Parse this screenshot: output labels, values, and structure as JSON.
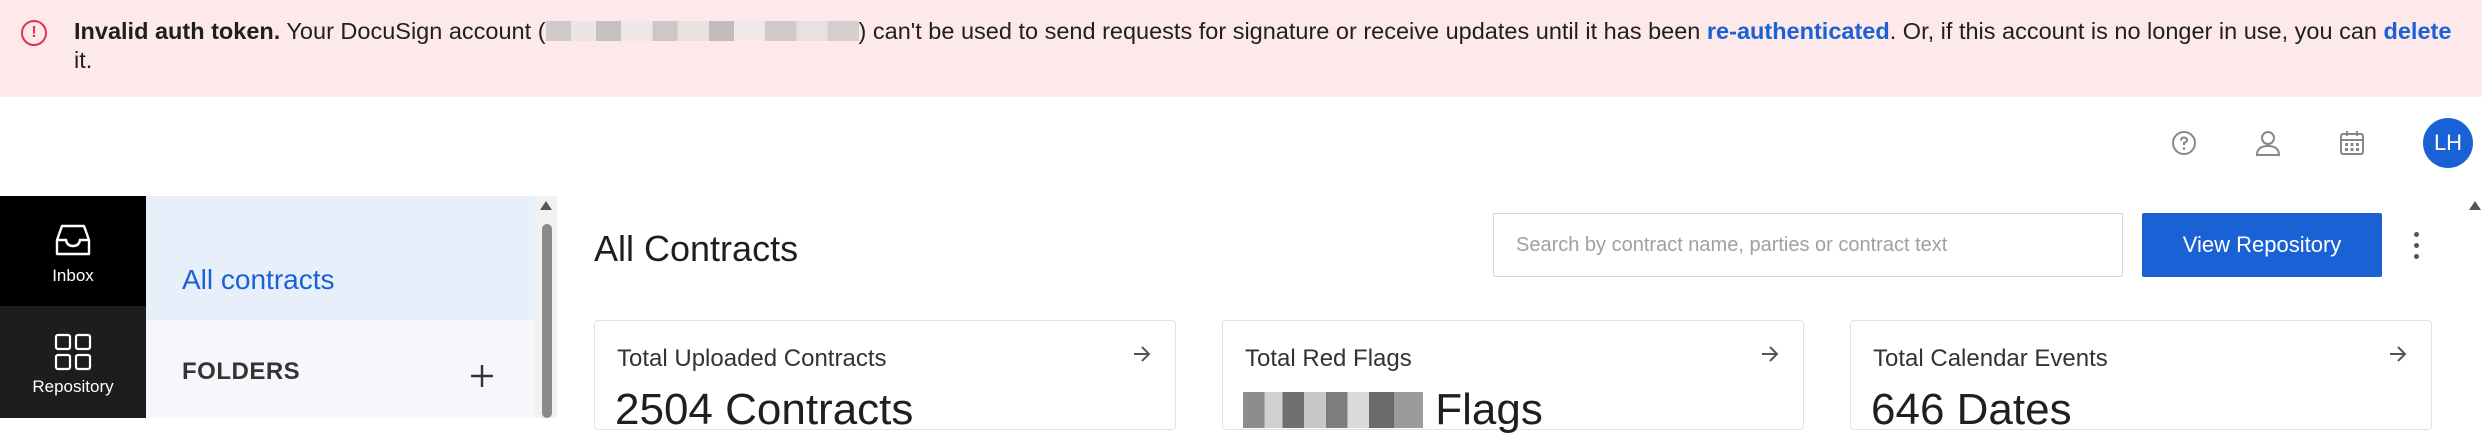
{
  "banner": {
    "title": "Invalid auth token.",
    "text_before": " Your DocuSign account (",
    "text_middle": ") can't be used to send requests for signature or receive updates until it has been ",
    "reauth_link": "re-authenticated",
    "text_after": ". Or, if this account is no longer in use, you can ",
    "delete_link": "delete",
    "text_end": " it."
  },
  "header": {
    "avatar_initials": "LH"
  },
  "sidebar": {
    "items": [
      {
        "label": "Inbox"
      },
      {
        "label": "Repository"
      }
    ]
  },
  "folder_panel": {
    "all_contracts": "All contracts",
    "folders_title": "FOLDERS"
  },
  "main": {
    "title": "All Contracts",
    "search_placeholder": "Search by contract name, parties or contract text",
    "view_repository_label": "View Repository",
    "cards": [
      {
        "label": "Total Uploaded Contracts",
        "value": "2504 Contracts"
      },
      {
        "label": "Total Red Flags",
        "value": "Flags"
      },
      {
        "label": "Total Calendar Events",
        "value": "646 Dates"
      }
    ]
  },
  "colors": {
    "accent": "#1a61d6",
    "banner_bg": "#fde8ea",
    "error_red": "#e2344a",
    "sidebar_bg": "#1d1d1d"
  },
  "icons": [
    "alert-circle-icon",
    "help-circle-icon",
    "user-icon",
    "calendar-icon",
    "inbox-icon",
    "grid-icon",
    "plus-icon",
    "arrow-right-icon",
    "kebab-icon"
  ]
}
